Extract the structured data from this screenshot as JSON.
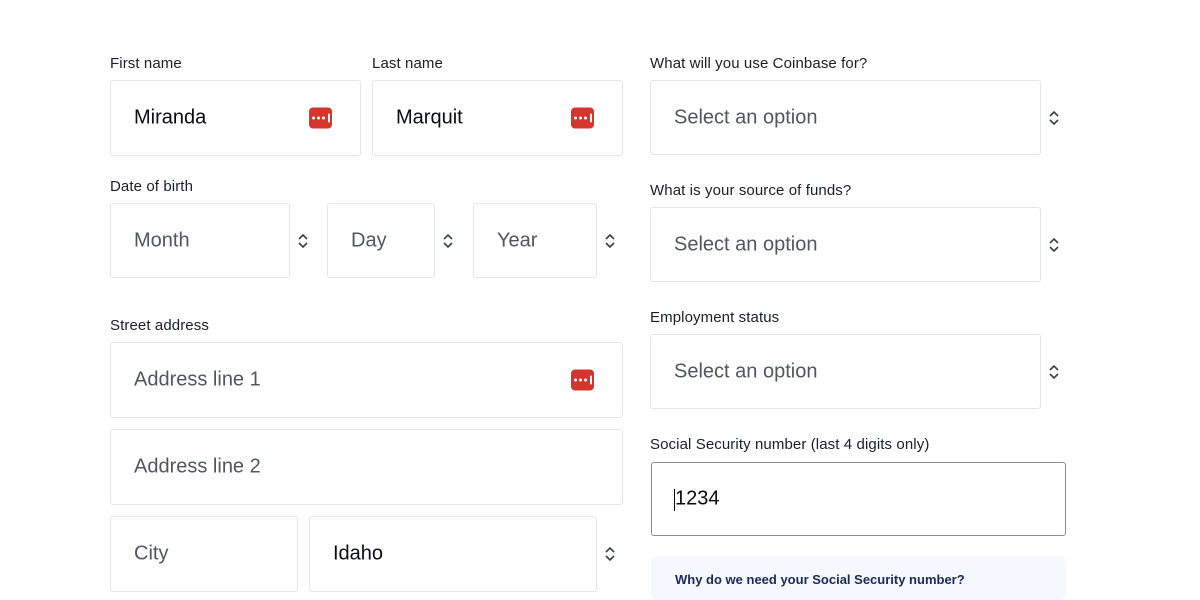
{
  "first_name": {
    "label": "First name",
    "value": "Miranda"
  },
  "last_name": {
    "label": "Last name",
    "value": "Marquit"
  },
  "dob": {
    "label": "Date of birth",
    "month_placeholder": "Month",
    "day_placeholder": "Day",
    "year_placeholder": "Year"
  },
  "address": {
    "label": "Street address",
    "line1_placeholder": "Address line 1",
    "line2_placeholder": "Address line 2",
    "city_placeholder": "City",
    "state_value": "Idaho"
  },
  "usage": {
    "label": "What will you use Coinbase for?",
    "placeholder": "Select an option"
  },
  "funds": {
    "label": "What is your source of funds?",
    "placeholder": "Select an option"
  },
  "employment": {
    "label": "Employment status",
    "placeholder": "Select an option"
  },
  "ssn": {
    "label": "Social Security number (last 4 digits only)",
    "value": "1234",
    "help_link": "Why do we need your Social Security number?"
  },
  "icons": {
    "password_manager": "password-manager-icon",
    "select_chevron": "chevron-up-down-icon"
  },
  "colors": {
    "password_manager": "#d5352c",
    "ssn_border": "#8a8d93",
    "help_bg": "#f5f8ff"
  }
}
